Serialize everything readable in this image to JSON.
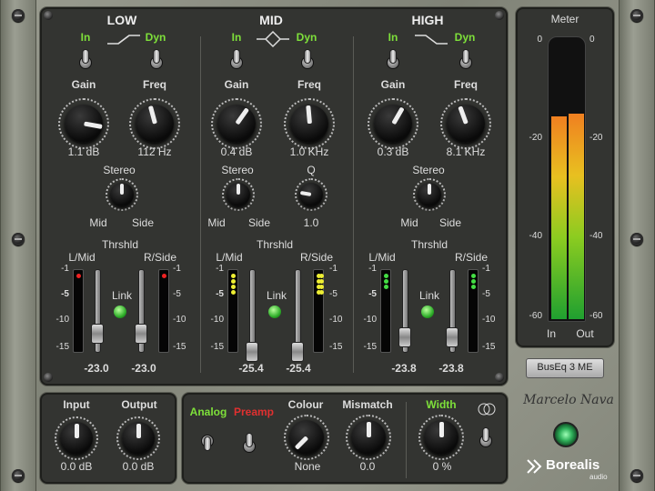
{
  "eq": {
    "low": {
      "title": "LOW",
      "in": "In",
      "dyn": "Dyn",
      "gain_label": "Gain",
      "freq_label": "Freq",
      "gain": "1.1 dB",
      "freq": "112 Hz",
      "stereo": "Stereo",
      "mid": "Mid",
      "side": "Side",
      "thrshld": "Thrshld",
      "lmid": "L/Mid",
      "rside": "R/Side",
      "link": "Link",
      "l_val": "-23.0",
      "r_val": "-23.0"
    },
    "mid": {
      "title": "MID",
      "in": "In",
      "dyn": "Dyn",
      "gain_label": "Gain",
      "freq_label": "Freq",
      "gain": "0.4 dB",
      "freq": "1.0 KHz",
      "stereo": "Stereo",
      "q_label": "Q",
      "q": "1.0",
      "mid": "Mid",
      "side": "Side",
      "thrshld": "Thrshld",
      "lmid": "L/Mid",
      "rside": "R/Side",
      "link": "Link",
      "l_val": "-25.4",
      "r_val": "-25.4"
    },
    "high": {
      "title": "HIGH",
      "in": "In",
      "dyn": "Dyn",
      "gain_label": "Gain",
      "freq_label": "Freq",
      "gain": "0.3 dB",
      "freq": "8.1 KHz",
      "stereo": "Stereo",
      "mid": "Mid",
      "side": "Side",
      "thrshld": "Thrshld",
      "lmid": "L/Mid",
      "rside": "R/Side",
      "link": "Link",
      "l_val": "-23.8",
      "r_val": "-23.8"
    },
    "scale": [
      "-1",
      "-5",
      "-10",
      "-15"
    ]
  },
  "meter": {
    "title": "Meter",
    "scale": [
      "0",
      "-20",
      "-40",
      "-60"
    ],
    "in": "In",
    "out": "Out",
    "in_level": 0.73,
    "out_level": 0.74
  },
  "io": {
    "input_label": "Input",
    "output_label": "Output",
    "input": "0.0 dB",
    "output": "0.0 dB"
  },
  "tone": {
    "analog": "Analog",
    "preamp": "Preamp",
    "colour_label": "Colour",
    "colour": "None",
    "mismatch_label": "Mismatch",
    "mismatch": "0.0",
    "width_label": "Width",
    "width": "0 %"
  },
  "preset": "BusEq 3 ME",
  "signature": "Marcelo Nava",
  "brand": "Borealis",
  "brand_sub": "audio"
}
